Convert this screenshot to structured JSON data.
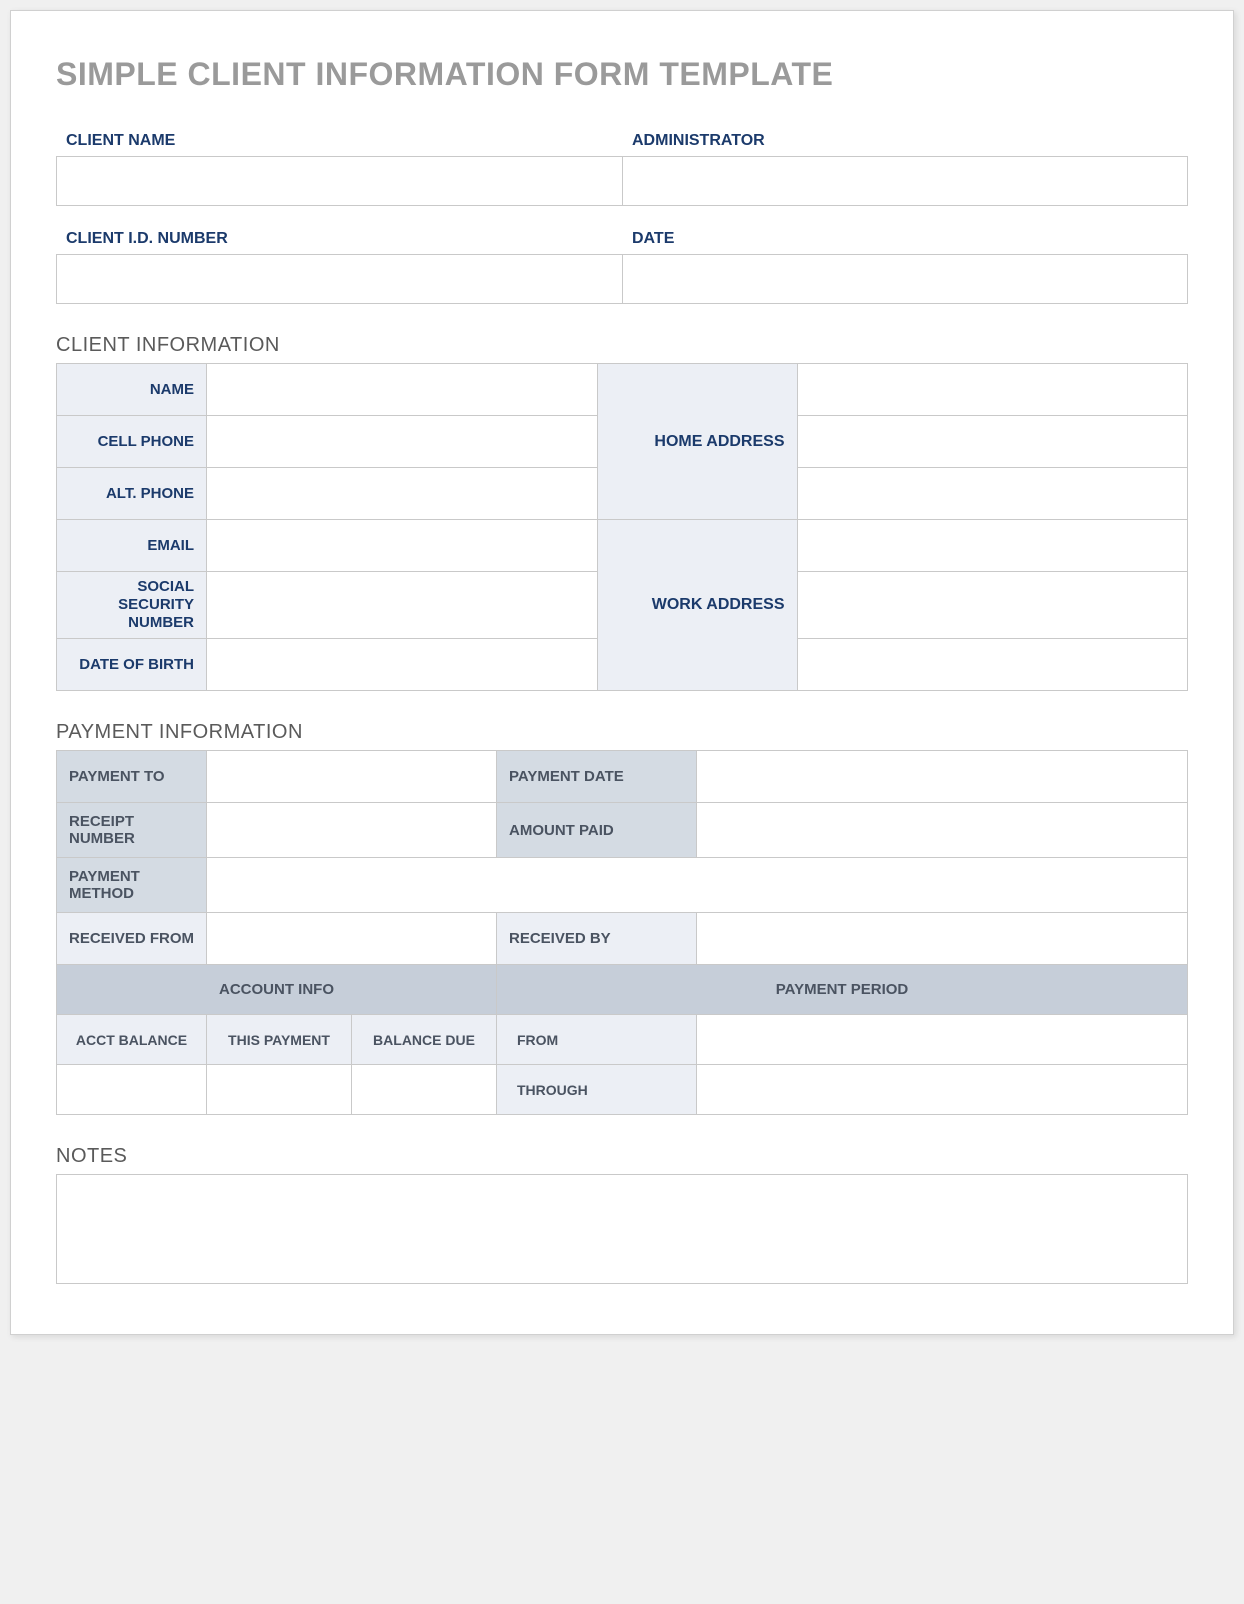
{
  "title": "SIMPLE CLIENT INFORMATION FORM TEMPLATE",
  "top": {
    "client_name_label": "CLIENT NAME",
    "client_name_value": "",
    "administrator_label": "ADMINISTRATOR",
    "administrator_value": "",
    "client_id_label": "CLIENT I.D. NUMBER",
    "client_id_value": "",
    "date_label": "DATE",
    "date_value": ""
  },
  "client_section_heading": "CLIENT INFORMATION",
  "client": {
    "name_label": "NAME",
    "name_value": "",
    "cell_label": "CELL PHONE",
    "cell_value": "",
    "alt_label": "ALT. PHONE",
    "alt_value": "",
    "email_label": "EMAIL",
    "email_value": "",
    "ssn_label": "SOCIAL SECURITY NUMBER",
    "ssn_value": "",
    "dob_label": "DATE OF BIRTH",
    "dob_value": "",
    "home_addr_label": "HOME ADDRESS",
    "home_addr_1": "",
    "home_addr_2": "",
    "home_addr_3": "",
    "work_addr_label": "WORK ADDRESS",
    "work_addr_1": "",
    "work_addr_2": "",
    "work_addr_3": ""
  },
  "payment_section_heading": "PAYMENT INFORMATION",
  "payment": {
    "payment_to_label": "PAYMENT TO",
    "payment_to_value": "",
    "payment_date_label": "PAYMENT DATE",
    "payment_date_value": "",
    "receipt_number_label": "RECEIPT NUMBER",
    "receipt_number_value": "",
    "amount_paid_label": "AMOUNT PAID",
    "amount_paid_value": "",
    "payment_method_label": "PAYMENT METHOD",
    "payment_method_value": "",
    "received_from_label": "RECEIVED FROM",
    "received_from_value": "",
    "received_by_label": "RECEIVED BY",
    "received_by_value": "",
    "account_info_header": "ACCOUNT INFO",
    "payment_period_header": "PAYMENT PERIOD",
    "acct_balance_label": "ACCT BALANCE",
    "this_payment_label": "THIS PAYMENT",
    "balance_due_label": "BALANCE DUE",
    "from_label": "FROM",
    "from_value": "",
    "through_label": "THROUGH",
    "through_value": "",
    "acct_balance_value": "",
    "this_payment_value": "",
    "balance_due_value": ""
  },
  "notes_heading": "NOTES",
  "notes_value": ""
}
